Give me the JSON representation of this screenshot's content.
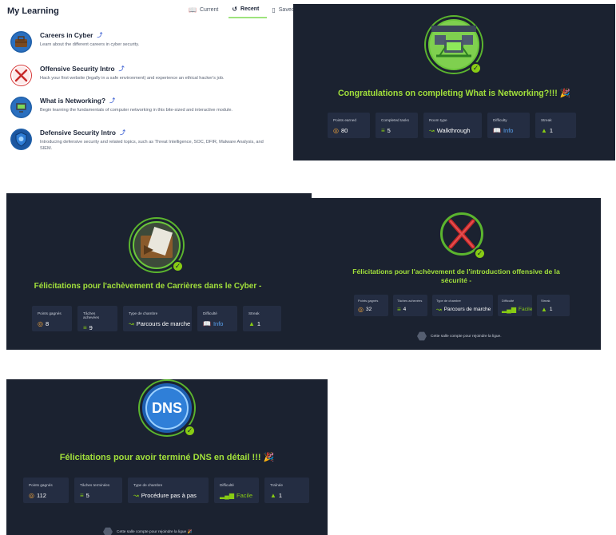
{
  "my_learning": {
    "title": "My Learning",
    "tabs": [
      {
        "label": "Current",
        "icon": "book-open-icon"
      },
      {
        "label": "Recent",
        "icon": "history-icon"
      },
      {
        "label": "Saved",
        "icon": "bookmark-icon"
      }
    ],
    "active_tab": "Recent",
    "courses": [
      {
        "title": "Careers in Cyber",
        "description": "Learn about the different careers in cyber security."
      },
      {
        "title": "Offensive Security Intro",
        "description": "Hack your first website (legally in a safe environment) and experience an ethical hacker's job."
      },
      {
        "title": "What is Networking?",
        "description": "Begin learning the fundamentals of computer networking in this bite-sized and interactive module."
      },
      {
        "title": "Defensive Security Intro",
        "description": "Introducing defensive security and related topics, such as Threat Intelligence, SOC, DFIR, Malware Analysis, and SIEM."
      }
    ]
  },
  "cards": {
    "networking": {
      "message": "Congratulations on completing What is Networking?!!! 🎉",
      "stats": [
        {
          "label": "Points earned",
          "value": "80",
          "icon": "target-icon"
        },
        {
          "label": "Completed tasks",
          "value": "5",
          "icon": "tasks-icon"
        },
        {
          "label": "Room type",
          "value": "Walkthrough",
          "icon": "path-icon"
        },
        {
          "label": "Difficulty",
          "value": "Info",
          "icon": "book-icon"
        },
        {
          "label": "Streak",
          "value": "1",
          "icon": "flame-icon"
        }
      ]
    },
    "careers": {
      "message": "Félicitations pour l'achèvement de Carrières dans le Cyber -",
      "stats": [
        {
          "label": "Points gagnés",
          "value": "8",
          "icon": "target-icon"
        },
        {
          "label": "Tâches achevées",
          "value": "9",
          "icon": "tasks-icon"
        },
        {
          "label": "Type de chambre",
          "value": "Parcours de marche",
          "icon": "path-icon"
        },
        {
          "label": "Difficulté",
          "value": "Info",
          "icon": "book-icon"
        },
        {
          "label": "Streak",
          "value": "1",
          "icon": "flame-icon"
        }
      ]
    },
    "offensive": {
      "message": "Félicitations pour l'achèvement de l'introduction offensive de la sécurité -",
      "stats": [
        {
          "label": "Points gagnés",
          "value": "32",
          "icon": "target-icon"
        },
        {
          "label": "Tâches achevées",
          "value": "4",
          "icon": "tasks-icon"
        },
        {
          "label": "Type de chambre",
          "value": "Parcours de marche",
          "icon": "path-icon"
        },
        {
          "label": "Difficulté",
          "value": "Facile",
          "icon": "signal-icon"
        },
        {
          "label": "Streak",
          "value": "1",
          "icon": "flame-icon"
        }
      ],
      "footer": "Cette salle compte pour rejoindre la ligue."
    },
    "dns": {
      "badge_text": "DNS",
      "message": "Félicitations pour avoir terminé DNS en détail !!! 🎉",
      "stats": [
        {
          "label": "Points gagnés",
          "value": "112",
          "icon": "target-icon"
        },
        {
          "label": "Tâches terminées",
          "value": "5",
          "icon": "tasks-icon"
        },
        {
          "label": "Type de chambre",
          "value": "Procédure pas à pas",
          "icon": "path-icon"
        },
        {
          "label": "Difficulté",
          "value": "Facile",
          "icon": "signal-icon"
        },
        {
          "label": "Traînée",
          "value": "1",
          "icon": "flame-icon"
        }
      ],
      "footer": "Cette salle compte pour rejoindre la ligue 🎉"
    }
  },
  "colors": {
    "card_bg": "#1b2230",
    "stat_bg": "#242d42",
    "accent_green": "#a2e03b",
    "check_green": "#88cc14",
    "info_blue": "#5aa2f0"
  }
}
